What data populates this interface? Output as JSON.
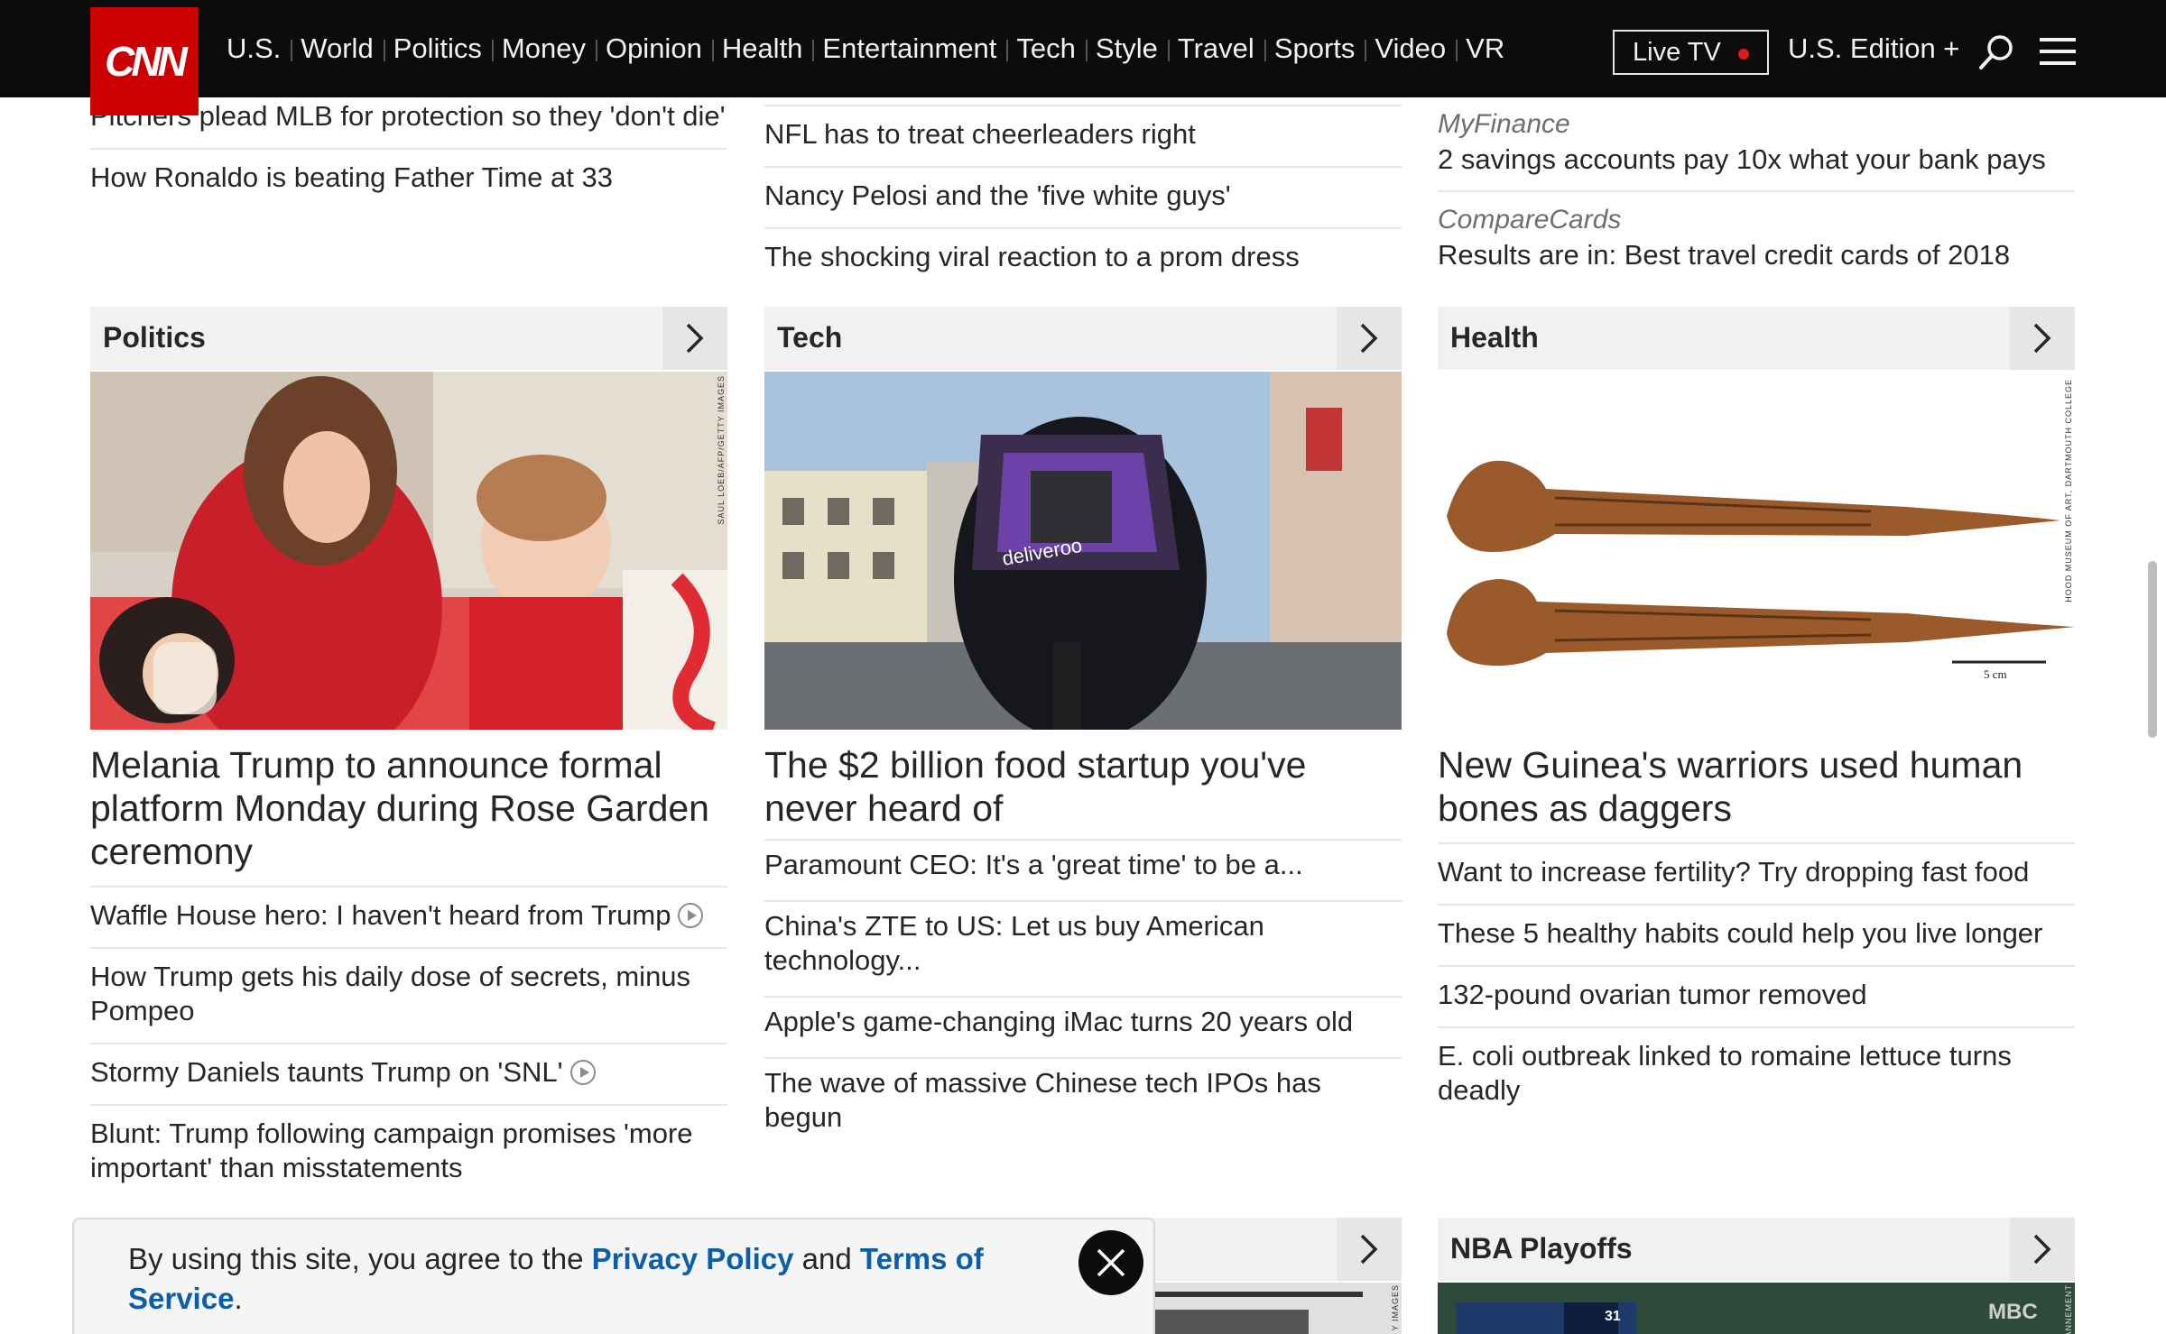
{
  "header": {
    "logo_text": "CNN",
    "nav": [
      "U.S.",
      "World",
      "Politics",
      "Money",
      "Opinion",
      "Health",
      "Entertainment",
      "Tech",
      "Style",
      "Travel",
      "Sports",
      "Video",
      "VR"
    ],
    "live_tv": "Live TV",
    "edition": "U.S. Edition +",
    "icons": {
      "search": "search-icon",
      "menu": "hamburger-menu-icon"
    }
  },
  "top_lists": {
    "col1": [
      "Pitchers plead MLB for protection so they 'don't die'",
      "How Ronaldo is beating Father Time at 33"
    ],
    "col2": [
      "NFL has to treat cheerleaders right",
      "Nancy Pelosi and the 'five white guys'",
      "The shocking viral reaction to a prom dress"
    ],
    "col3": [
      {
        "sponsor": "MyFinance",
        "text": "2 savings accounts pay 10x what your bank pays"
      },
      {
        "sponsor": "CompareCards",
        "text": "Results are in: Best travel credit cards of 2018"
      }
    ]
  },
  "sections": {
    "politics": {
      "title": "Politics",
      "photo_credit": "SAUL LOEB/AFP/GETTY IMAGES",
      "headline": "Melania Trump to announce formal platform Monday during Rose Garden ceremony",
      "items": [
        {
          "text": "Waffle House hero: I haven't heard from Trump",
          "video": true
        },
        {
          "text": "How Trump gets his daily dose of secrets, minus Pompeo",
          "video": false
        },
        {
          "text": "Stormy Daniels taunts Trump on 'SNL'",
          "video": true
        },
        {
          "text": "Blunt: Trump following campaign promises 'more important' than misstatements",
          "video": false
        }
      ]
    },
    "tech": {
      "title": "Tech",
      "photo_text": "deliveroo",
      "headline": "The $2 billion food startup you've never heard of",
      "items": [
        "Paramount CEO: It's a 'great time' to be a...",
        "China's ZTE to US: Let us buy American technology...",
        "Apple's game-changing iMac turns 20 years old",
        "The wave of massive Chinese tech IPOs has begun"
      ]
    },
    "health": {
      "title": "Health",
      "photo_credit": "HOOD MUSEUM OF ART, DARTMOUTH COLLEGE",
      "photo_scale": "5 cm",
      "headline": "New Guinea's warriors used human bones as daggers",
      "items": [
        "Want to increase fertility? Try dropping fast food",
        "These 5 healthy habits could help you live longer",
        "132-pound ovarian tumor removed",
        "E. coli outbreak linked to romaine lettuce turns deadly"
      ]
    },
    "nba": {
      "title": "NBA Playoffs",
      "photo_text": "MBC",
      "score_a": "31"
    },
    "bottom_mid_credit": "Y IMAGES",
    "bottom_right_credit": "ZANNEMENT"
  },
  "cookie": {
    "prefix": "By using this site, you agree to the ",
    "privacy": "Privacy Policy",
    "middle": " and ",
    "terms": "Terms of Service",
    "suffix": "."
  },
  "colors": {
    "brand": "#cc0000",
    "nav_bg": "#0c0c0c",
    "link_blue": "#0c5ea8",
    "live_dot": "#e0191c"
  }
}
